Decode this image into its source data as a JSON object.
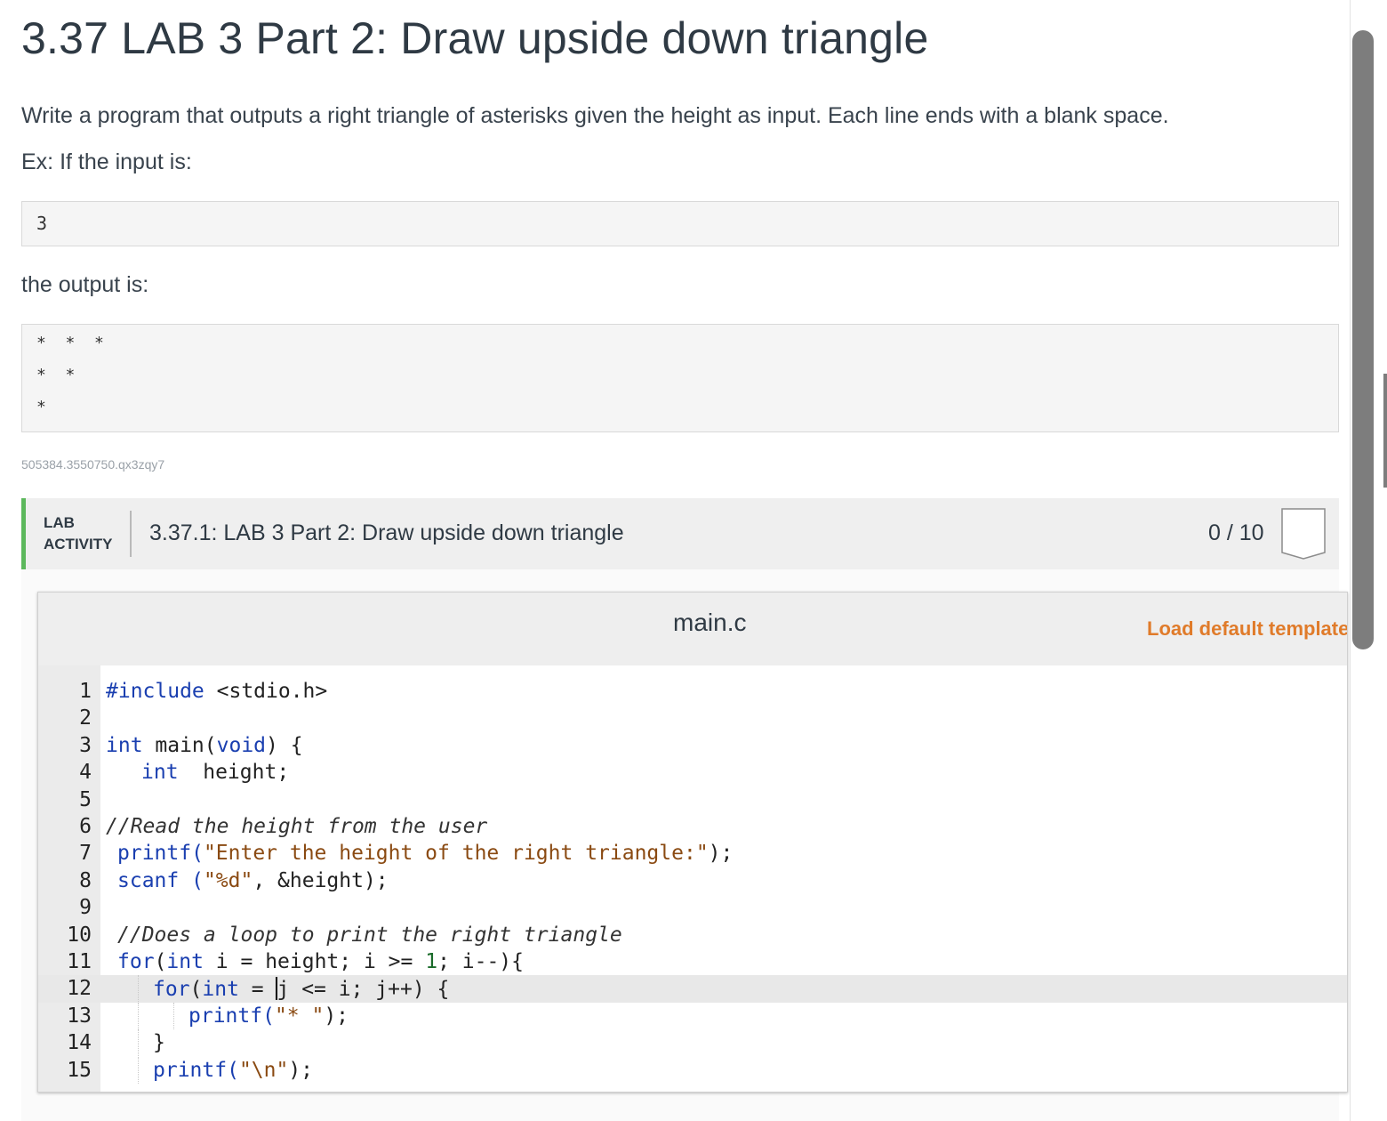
{
  "page": {
    "title": "3.37 LAB 3 Part 2: Draw upside down triangle",
    "description": "Write a program that outputs a right triangle of asterisks given the height as input. Each line ends with a blank space.",
    "example_intro": "Ex: If the input is:",
    "example_input": "3",
    "output_intro": "the output is:",
    "example_output": [
      "*  *  *",
      "*  *",
      "*"
    ],
    "content_id": "505384.3550750.qx3zqy7"
  },
  "lab": {
    "tag_line1": "LAB",
    "tag_line2": "ACTIVITY",
    "title": "3.37.1: LAB 3 Part 2: Draw upside down triangle",
    "score": "0 / 10",
    "accent_color": "#5cb85c"
  },
  "editor": {
    "file_name": "main.c",
    "load_template_label": "Load default template...",
    "active_line": 12,
    "lines": [
      {
        "n": "1"
      },
      {
        "n": "2"
      },
      {
        "n": "3"
      },
      {
        "n": "4"
      },
      {
        "n": "5"
      },
      {
        "n": "6"
      },
      {
        "n": "7"
      },
      {
        "n": "8"
      },
      {
        "n": "9"
      },
      {
        "n": "10"
      },
      {
        "n": "11"
      },
      {
        "n": "12"
      },
      {
        "n": "13"
      },
      {
        "n": "14"
      },
      {
        "n": "15"
      }
    ],
    "code": {
      "l1_meta": "#include",
      "l1_rest": " <stdio.h>",
      "l3_kw1": "int",
      "l3_rest1": " main(",
      "l3_kw2": "void",
      "l3_rest2": ") {",
      "l4_kw": "int",
      "l4_rest": "  height;",
      "l6_cm": "//Read the height from the user",
      "l7_a": "printf(",
      "l7_str": "\"Enter the height of the right triangle:\"",
      "l7_b": ");",
      "l8_a": "scanf (",
      "l8_str": "\"%d\"",
      "l8_b": ", &height);",
      "l10_cm": "//Does a loop to print the right triangle",
      "l11_kw1": "for",
      "l11_a": "(",
      "l11_kw2": "int",
      "l11_b": " i = height; i >= ",
      "l11_num": "1",
      "l11_c": "; i--){",
      "l12_kw1": "for",
      "l12_a": "(",
      "l12_kw2": "int",
      "l12_b": " = ",
      "l12_c": "j <= i; j++) {",
      "l13_a": "printf(",
      "l13_str": "\"* \"",
      "l13_b": ");",
      "l14_a": "}",
      "l15_a": "printf(",
      "l15_str": "\"\\n\"",
      "l15_b": ");"
    }
  },
  "colors": {
    "keyword": "#1a3fb0",
    "string": "#8a4a12",
    "number": "#1a6b2a",
    "link": "#e07b2a"
  }
}
